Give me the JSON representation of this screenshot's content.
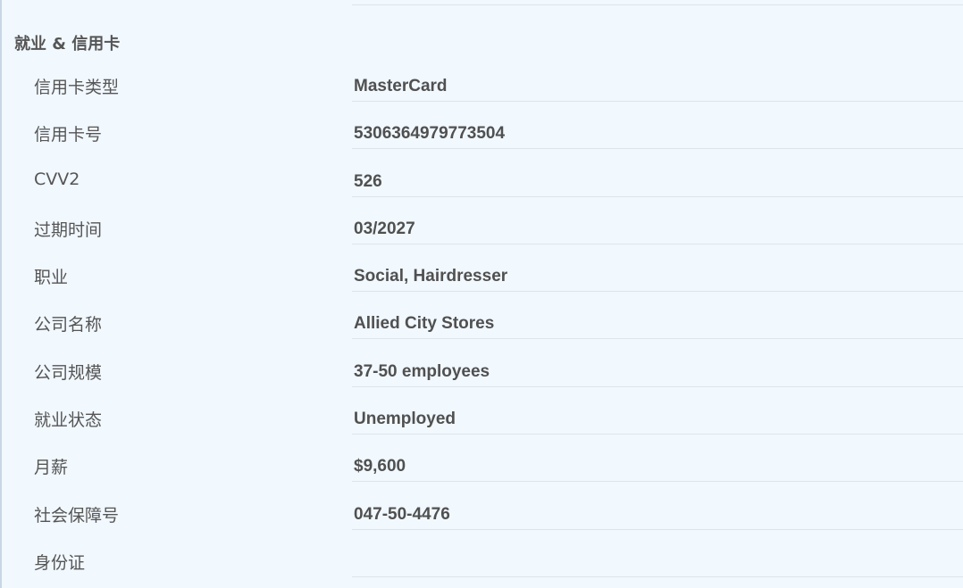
{
  "section": {
    "title": "就业 & 信用卡"
  },
  "rows": [
    {
      "label": "信用卡类型",
      "value": "MasterCard"
    },
    {
      "label": "信用卡号",
      "value": "5306364979773504"
    },
    {
      "label": "CVV2",
      "value": "526"
    },
    {
      "label": "过期时间",
      "value": "03/2027"
    },
    {
      "label": "职业",
      "value": "Social, Hairdresser"
    },
    {
      "label": "公司名称",
      "value": "Allied City Stores"
    },
    {
      "label": "公司规模",
      "value": "37-50 employees"
    },
    {
      "label": "就业状态",
      "value": "Unemployed"
    },
    {
      "label": "月薪",
      "value": "$9,600"
    },
    {
      "label": "社会保障号",
      "value": "047-50-4476"
    },
    {
      "label": "身份证",
      "value": ""
    }
  ],
  "colors": {
    "background": "#f1f8fe",
    "text": "#555555",
    "divider": "#dde4ea"
  }
}
